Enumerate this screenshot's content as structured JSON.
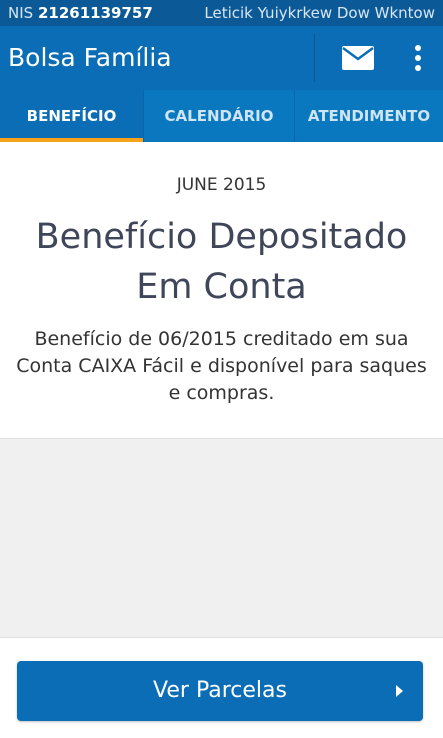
{
  "status_bar": {
    "nis_label": "NIS",
    "nis_number": "21261139757",
    "user_name": "Leticik Yuiykrkew Dow Wkntow"
  },
  "app_bar": {
    "title": "Bolsa Família",
    "icons": [
      "mail-icon",
      "more-vert-icon"
    ]
  },
  "tabs": [
    {
      "label": "BENEFÍCIO",
      "active": true
    },
    {
      "label": "CALENDÁRIO",
      "active": false
    },
    {
      "label": "ATENDIMENTO",
      "active": false
    }
  ],
  "benefit": {
    "month": "JUNE 2015",
    "status_line1": "Benefício Depositado",
    "status_line2": "Em Conta",
    "description": "Benefício de 06/2015 creditado em sua Conta CAIXA Fácil e disponível para saques e compras."
  },
  "footer": {
    "button_label": "Ver Parcelas",
    "button_icon": "chevron-right-icon"
  },
  "colors": {
    "primary": "#0b6db6",
    "status_bar": "#0b5a97",
    "tab_indicator": "#f7a21b"
  }
}
